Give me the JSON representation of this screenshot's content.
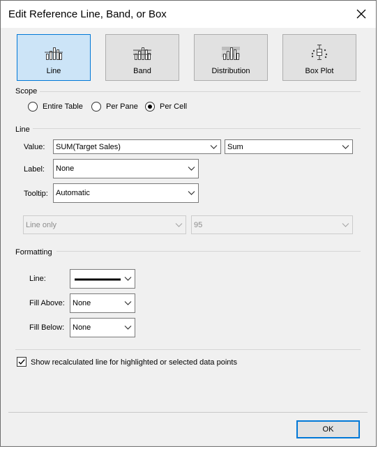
{
  "window": {
    "title": "Edit Reference Line, Band, or Box"
  },
  "type_buttons": [
    {
      "label": "Line",
      "icon": "reference-line-icon",
      "selected": true
    },
    {
      "label": "Band",
      "icon": "reference-band-icon",
      "selected": false
    },
    {
      "label": "Distribution",
      "icon": "distribution-icon",
      "selected": false
    },
    {
      "label": "Box Plot",
      "icon": "box-plot-icon",
      "selected": false
    }
  ],
  "scope": {
    "label": "Scope",
    "options": [
      {
        "label": "Entire Table",
        "checked": false
      },
      {
        "label": "Per Pane",
        "checked": false
      },
      {
        "label": "Per Cell",
        "checked": true
      }
    ]
  },
  "line_section": {
    "label": "Line",
    "value_label": "Value:",
    "value": "SUM(Target Sales)",
    "aggregation": "Sum",
    "label_label": "Label:",
    "label_value": "None",
    "tooltip_label": "Tooltip:",
    "tooltip_value": "Automatic",
    "ci_type": "Line only",
    "ci_value": "95"
  },
  "formatting": {
    "label": "Formatting",
    "line_label": "Line:",
    "fill_above_label": "Fill Above:",
    "fill_above_value": "None",
    "fill_below_label": "Fill Below:",
    "fill_below_value": "None"
  },
  "recalc": {
    "label": "Show recalculated line for highlighted or selected data points",
    "checked": true
  },
  "ok_label": "OK",
  "colors": {
    "accent": "#0078d7",
    "selected_bg": "#cce4f7",
    "dialog_bg": "#f0f0f0"
  }
}
